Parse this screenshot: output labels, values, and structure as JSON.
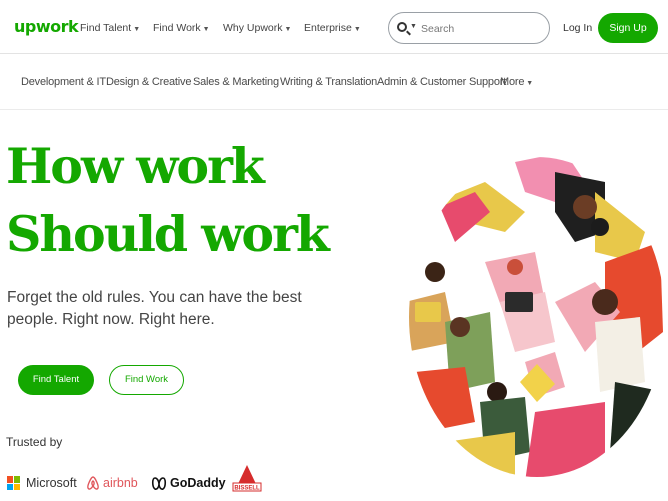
{
  "nav": {
    "logo": "upwork",
    "links": [
      {
        "label": "Find Talent"
      },
      {
        "label": "Find Work"
      },
      {
        "label": "Why Upwork"
      },
      {
        "label": "Enterprise"
      }
    ],
    "search_placeholder": "Search",
    "login": "Log In",
    "signup": "Sign Up"
  },
  "categories": [
    "Development & IT",
    "Design & Creative",
    "Sales & Marketing",
    "Writing & Translation",
    "Admin & Customer Support",
    "More"
  ],
  "hero": {
    "headline_line1": "How work",
    "headline_line2": "Should work",
    "subtitle": "Forget the old rules. You can have the best people. Right now. Right here.",
    "find_talent": "Find Talent",
    "find_work": "Find Work"
  },
  "trusted": {
    "label": "Trusted by",
    "brands": [
      "Microsoft",
      "airbnb",
      "GoDaddy",
      "BISSELL"
    ]
  },
  "colors": {
    "brand_green": "#14a800",
    "airbnb": "#e0565b",
    "bissell": "#d62c2c"
  }
}
